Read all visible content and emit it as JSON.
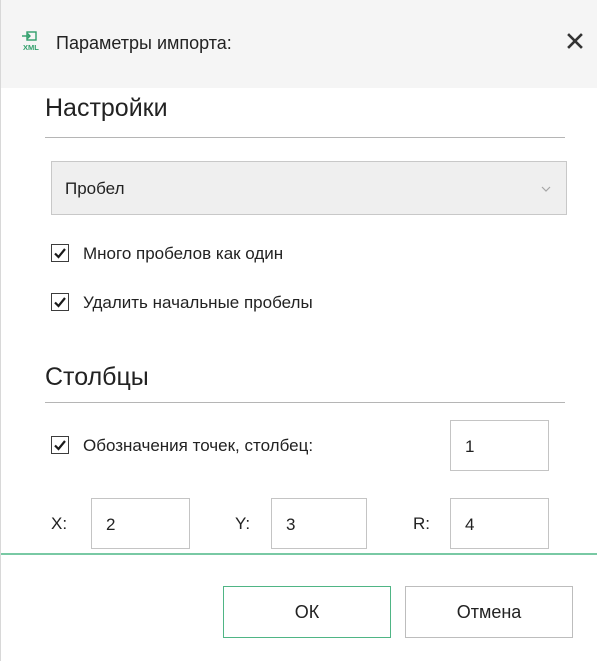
{
  "window": {
    "title": "Параметры импорта:",
    "icon": "xml-import-icon",
    "icon_caption": "XML",
    "close_icon": "close-icon"
  },
  "settings": {
    "heading": "Настройки",
    "separator": {
      "selected": "Пробел",
      "arrow_icon": "chevron-down-icon"
    },
    "options": [
      {
        "label": "Много пробелов как один",
        "checked": true
      },
      {
        "label": "Удалить начальные пробелы",
        "checked": true
      }
    ]
  },
  "columns": {
    "heading": "Столбцы",
    "point_names": {
      "label": "Обозначения точек, столбец:",
      "checked": true,
      "value": "1"
    },
    "x": {
      "label": "X:",
      "value": "2"
    },
    "y": {
      "label": "Y:",
      "value": "3"
    },
    "r": {
      "label": "R:",
      "value": "4"
    }
  },
  "buttons": {
    "ok": "ОК",
    "cancel": "Отмена"
  },
  "colors": {
    "accent": "#4fb585",
    "footer_rule": "#79c9a4",
    "titlebar": "#f5f5f5",
    "combo_bg": "#efefef"
  }
}
